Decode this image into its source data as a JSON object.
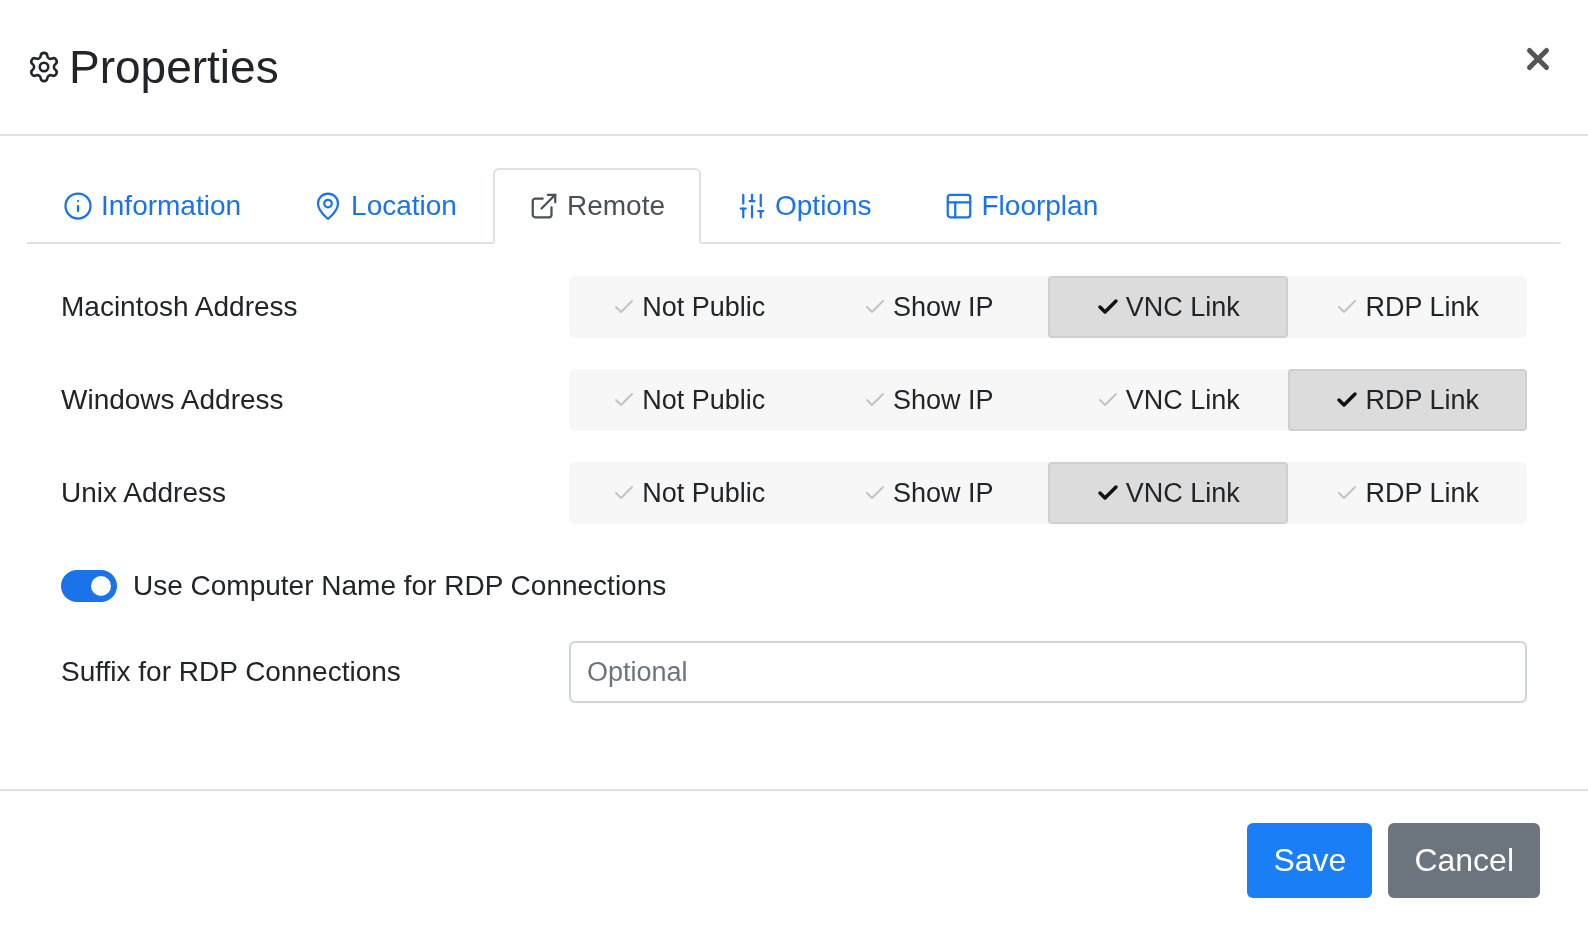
{
  "header": {
    "title": "Properties"
  },
  "tabs": [
    {
      "label": "Information",
      "kind": "info",
      "selected": false
    },
    {
      "label": "Location",
      "kind": "location",
      "selected": false
    },
    {
      "label": "Remote",
      "kind": "remote",
      "selected": true
    },
    {
      "label": "Options",
      "kind": "options",
      "selected": false
    },
    {
      "label": "Floorplan",
      "kind": "floorplan",
      "selected": false
    }
  ],
  "rows": [
    {
      "label": "Macintosh Address",
      "options": [
        {
          "label": "Not Public",
          "selected": false
        },
        {
          "label": "Show IP",
          "selected": false
        },
        {
          "label": "VNC Link",
          "selected": true
        },
        {
          "label": "RDP Link",
          "selected": false
        }
      ]
    },
    {
      "label": "Windows Address",
      "options": [
        {
          "label": "Not Public",
          "selected": false
        },
        {
          "label": "Show IP",
          "selected": false
        },
        {
          "label": "VNC Link",
          "selected": false
        },
        {
          "label": "RDP Link",
          "selected": true
        }
      ]
    },
    {
      "label": "Unix Address",
      "options": [
        {
          "label": "Not Public",
          "selected": false
        },
        {
          "label": "Show IP",
          "selected": false
        },
        {
          "label": "VNC Link",
          "selected": true
        },
        {
          "label": "RDP Link",
          "selected": false
        }
      ]
    }
  ],
  "toggle": {
    "label": "Use Computer Name for RDP Connections",
    "on": true
  },
  "suffix": {
    "label": "Suffix for RDP Connections",
    "placeholder": "Optional"
  },
  "buttons": [
    {
      "label": "Save",
      "kind": "primary"
    },
    {
      "label": "Cancel",
      "kind": "secondary"
    }
  ]
}
